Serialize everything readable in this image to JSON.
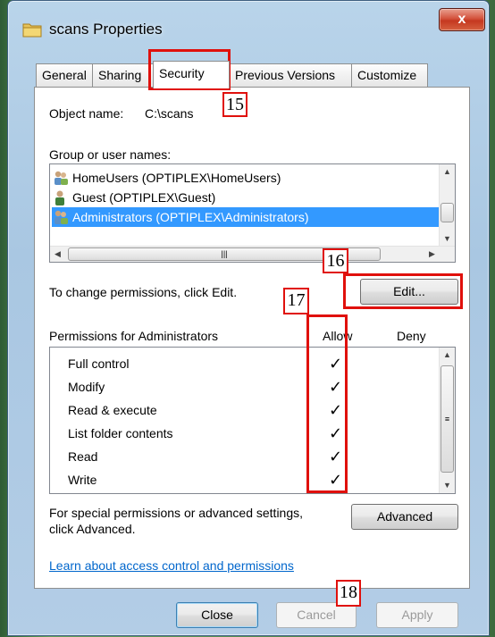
{
  "window": {
    "title": "scans Properties",
    "close_glyph": "x"
  },
  "tabs": [
    {
      "label": "General"
    },
    {
      "label": "Sharing"
    },
    {
      "label": "Security"
    },
    {
      "label": "Previous Versions"
    },
    {
      "label": "Customize"
    }
  ],
  "object": {
    "label": "Object name:",
    "value": "C:\\scans"
  },
  "group_label": "Group or user names:",
  "users": [
    {
      "name": "HomeUsers (OPTIPLEX\\HomeUsers)",
      "icon": "group-icon",
      "selected": false
    },
    {
      "name": "Guest (OPTIPLEX\\Guest)",
      "icon": "user-icon",
      "selected": false
    },
    {
      "name": "Administrators (OPTIPLEX\\Administrators)",
      "icon": "group-icon",
      "selected": true
    }
  ],
  "change_text": "To change permissions, click Edit.",
  "edit_label": "Edit...",
  "permissions": {
    "header": "Permissions for Administrators",
    "allow_header": "Allow",
    "deny_header": "Deny",
    "check_glyph": "✓",
    "rows": [
      {
        "name": "Full control",
        "allow": true,
        "deny": false
      },
      {
        "name": "Modify",
        "allow": true,
        "deny": false
      },
      {
        "name": "Read & execute",
        "allow": true,
        "deny": false
      },
      {
        "name": "List folder contents",
        "allow": true,
        "deny": false
      },
      {
        "name": "Read",
        "allow": true,
        "deny": false
      },
      {
        "name": "Write",
        "allow": true,
        "deny": false
      }
    ]
  },
  "special": {
    "line1": "For special permissions or advanced settings,",
    "line2": "click Advanced."
  },
  "advanced_label": "Advanced",
  "learn_link": "Learn about access control and permissions",
  "footer": {
    "close": "Close",
    "cancel": "Cancel",
    "apply": "Apply"
  },
  "annotations": [
    "15",
    "16",
    "17",
    "18"
  ],
  "colors": {
    "annotation": "#e0100c",
    "selection": "#3399ff",
    "link": "#0066cc"
  }
}
